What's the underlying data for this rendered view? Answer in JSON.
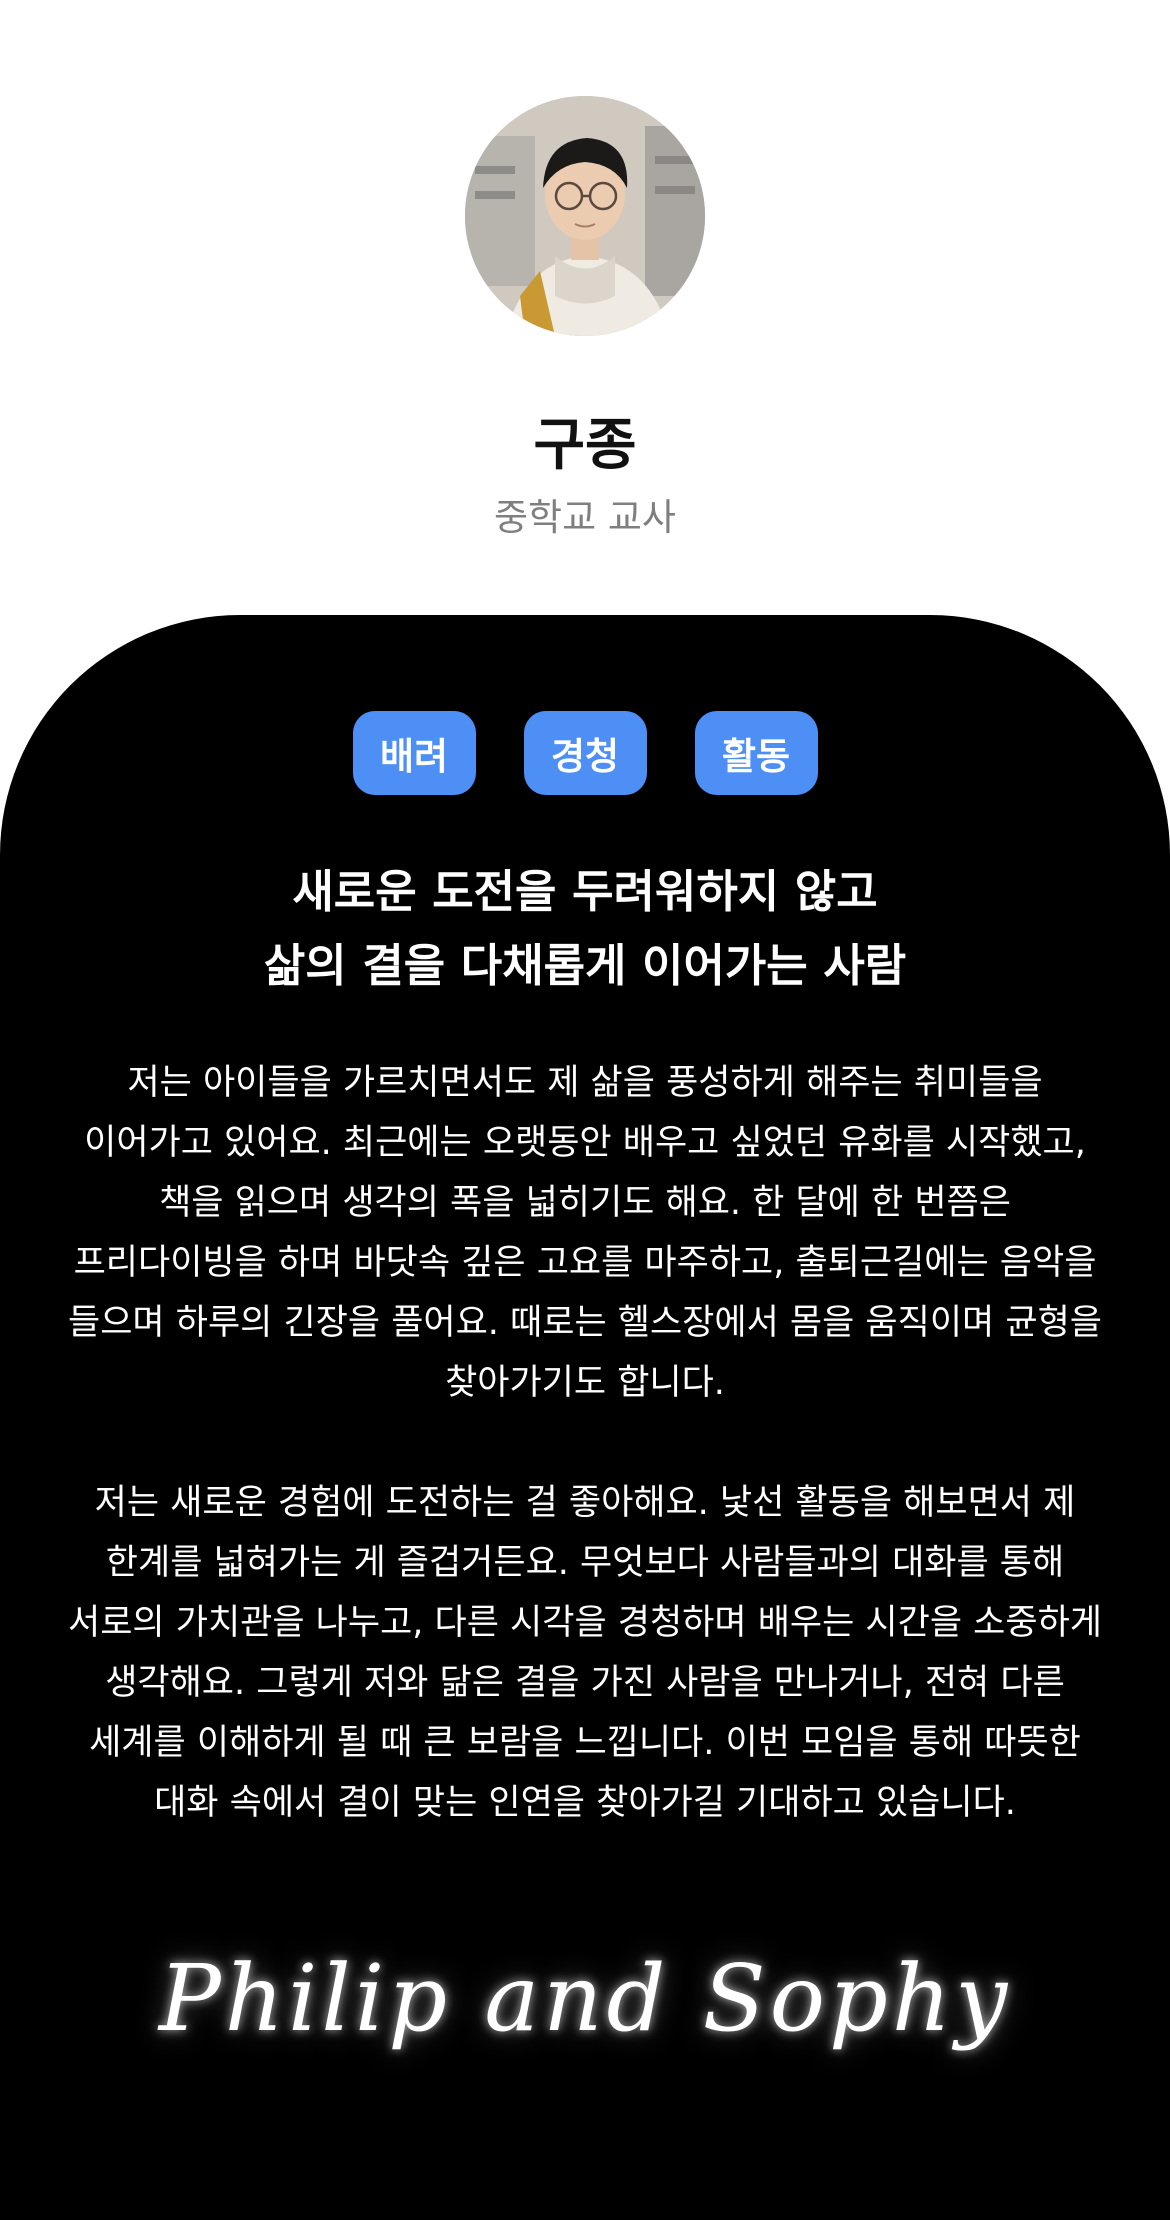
{
  "profile": {
    "name": "구종",
    "role": "중학교 교사"
  },
  "tags": [
    "배려",
    "경청",
    "활동"
  ],
  "headline": {
    "line1": "새로운 도전을 두려워하지 않고",
    "line2": "삶의 결을 다채롭게 이어가는 사람"
  },
  "paragraphs": [
    "저는 아이들을 가르치면서도 제 삶을 풍성하게 해주는 취미들을 이어가고 있어요. 최근에는 오랫동안 배우고 싶었던 유화를 시작했고, 책을 읽으며 생각의 폭을 넓히기도 해요. 한 달에 한 번쯤은 프리다이빙을 하며 바닷속 깊은 고요를 마주하고, 출퇴근길에는 음악을 들으며 하루의 긴장을 풀어요. 때로는 헬스장에서 몸을 움직이며 균형을 찾아가기도 합니다.",
    "저는 새로운 경험에 도전하는 걸 좋아해요. 낯선 활동을 해보면서 제 한계를 넓혀가는 게 즐겁거든요. 무엇보다 사람들과의 대화를 통해 서로의 가치관을 나누고, 다른 시각을 경청하며 배우는 시간을 소중하게 생각해요. 그렇게 저와 닮은 결을 가진 사람을 만나거나, 전혀 다른 세계를 이해하게 될 때 큰 보람을 느낍니다. 이번 모임을 통해 따뜻한 대화 속에서 결이 맞는 인연을 찾아가길 기대하고 있습니다."
  ],
  "signature": "Philip and Sophy",
  "colors": {
    "tag_bg": "#4d8ff5",
    "card_bg": "#000000",
    "role_text": "#7f7f7f"
  }
}
